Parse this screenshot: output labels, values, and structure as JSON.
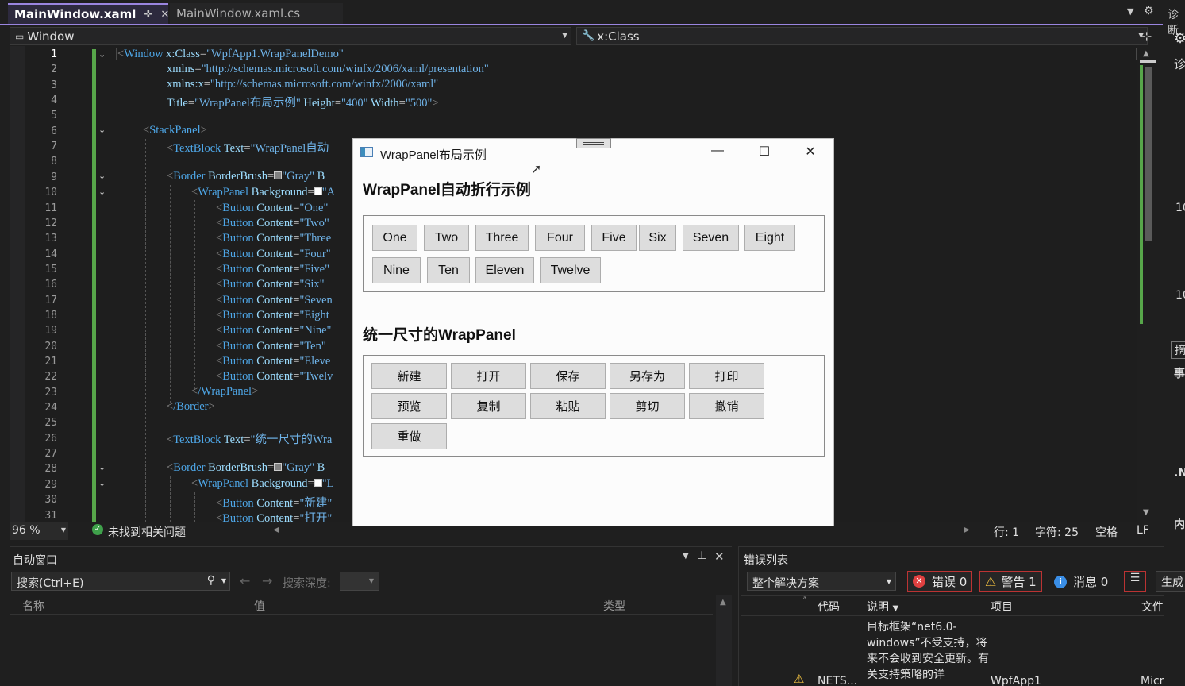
{
  "tabs": [
    {
      "label": "MainWindow.xaml",
      "active": true
    },
    {
      "label": "MainWindow.xaml.cs",
      "active": false
    }
  ],
  "navbar": {
    "left": "Window",
    "right": "x:Class"
  },
  "line_numbers": [
    "1",
    "2",
    "3",
    "4",
    "5",
    "6",
    "7",
    "8",
    "9",
    "10",
    "11",
    "12",
    "13",
    "14",
    "15",
    "16",
    "17",
    "18",
    "19",
    "20",
    "21",
    "22",
    "23",
    "24",
    "25",
    "26",
    "27",
    "28",
    "29",
    "30",
    "31"
  ],
  "code": {
    "l1": {
      "tag": "Window",
      "attr": "x:Class",
      "val": "\"WpfApp1.WrapPanelDemo\""
    },
    "l2": {
      "attr": "xmlns",
      "val": "\"http://schemas.microsoft.com/winfx/2006/xaml/presentation\""
    },
    "l3": {
      "attr": "xmlns:x",
      "val": "\"http://schemas.microsoft.com/winfx/2006/xaml\""
    },
    "l4": {
      "attr1": "Title",
      "val1": "\"WrapPanel布局示例\"",
      "attr2": "Height",
      "val2": "\"400\"",
      "attr3": "Width",
      "val3": "\"500\""
    },
    "l6": {
      "tag": "StackPanel"
    },
    "l7": {
      "tag": "TextBlock",
      "attr": "Text",
      "val": "\"WrapPanel自动"
    },
    "l9": {
      "tag": "Border",
      "attr": "BorderBrush",
      "val": "\"Gray\"",
      "tail": "B"
    },
    "l10": {
      "tag": "WrapPanel",
      "attr": "Background",
      "val": "\"A"
    },
    "l11": {
      "tag": "Button",
      "attr": "Content",
      "val": "\"One\""
    },
    "l12": {
      "tag": "Button",
      "attr": "Content",
      "val": "\"Two\""
    },
    "l13": {
      "tag": "Button",
      "attr": "Content",
      "val": "\"Three"
    },
    "l14": {
      "tag": "Button",
      "attr": "Content",
      "val": "\"Four\""
    },
    "l15": {
      "tag": "Button",
      "attr": "Content",
      "val": "\"Five\""
    },
    "l16": {
      "tag": "Button",
      "attr": "Content",
      "val": "\"Six\""
    },
    "l17": {
      "tag": "Button",
      "attr": "Content",
      "val": "\"Seven"
    },
    "l18": {
      "tag": "Button",
      "attr": "Content",
      "val": "\"Eight"
    },
    "l19": {
      "tag": "Button",
      "attr": "Content",
      "val": "\"Nine\""
    },
    "l20": {
      "tag": "Button",
      "attr": "Content",
      "val": "\"Ten\""
    },
    "l21": {
      "tag": "Button",
      "attr": "Content",
      "val": "\"Eleve"
    },
    "l22": {
      "tag": "Button",
      "attr": "Content",
      "val": "\"Twelv"
    },
    "l23": {
      "tag": "/WrapPanel"
    },
    "l24": {
      "tag": "/Border"
    },
    "l26": {
      "tag": "TextBlock",
      "attr": "Text",
      "val": "\"统一尺寸的Wra"
    },
    "l28": {
      "tag": "Border",
      "attr": "BorderBrush",
      "val": "\"Gray\"",
      "tail": "B"
    },
    "l29": {
      "tag": "WrapPanel",
      "attr": "Background",
      "val": "\"L"
    },
    "l30": {
      "tag": "Button",
      "attr": "Content",
      "val": "\"新建\""
    },
    "l31": {
      "tag": "Button",
      "attr": "Content",
      "val": "\"打开\""
    }
  },
  "editor_status": {
    "zoom": "96 %",
    "issues": "未找到相关问题",
    "line": "行: 1",
    "col": "字符: 25",
    "spaces": "空格",
    "eol": "LF"
  },
  "wpf": {
    "title": "WrapPanel布局示例",
    "heading1": "WrapPanel自动折行示例",
    "buttons1": [
      "One",
      "Two",
      "Three",
      "Four",
      "Five",
      "Six",
      "Seven",
      "Eight",
      "Nine",
      "Ten",
      "Eleven",
      "Twelve"
    ],
    "heading2": "统一尺寸的WrapPanel",
    "buttons2": [
      "新建",
      "打开",
      "保存",
      "另存为",
      "打印",
      "预览",
      "复制",
      "粘贴",
      "剪切",
      "撤销",
      "重做"
    ]
  },
  "autos": {
    "title": "自动窗口",
    "search_placeholder": "搜索(Ctrl+E)",
    "search_depth": "搜索深度:",
    "col_name": "名称",
    "col_value": "值",
    "col_type": "类型"
  },
  "errors": {
    "title": "错误列表",
    "scope": "整个解决方案",
    "errors": "错误 0",
    "warnings": "警告 1",
    "messages": "消息 0",
    "build": "生成",
    "col_code": "代码",
    "col_desc": "说明",
    "col_project": "项目",
    "col_file": "文件",
    "row_code": "NETS...",
    "row_desc": "目标框架“net6.0-windows”不受支持，将来不会收到安全更新。有关支持策略的详",
    "row_project": "WpfApp1",
    "row_file": "Microso"
  },
  "right_strip": [
    "诊断",
    "⚙",
    "诊",
    "10",
    "10",
    "摘",
    "事",
    ".N",
    "内"
  ]
}
